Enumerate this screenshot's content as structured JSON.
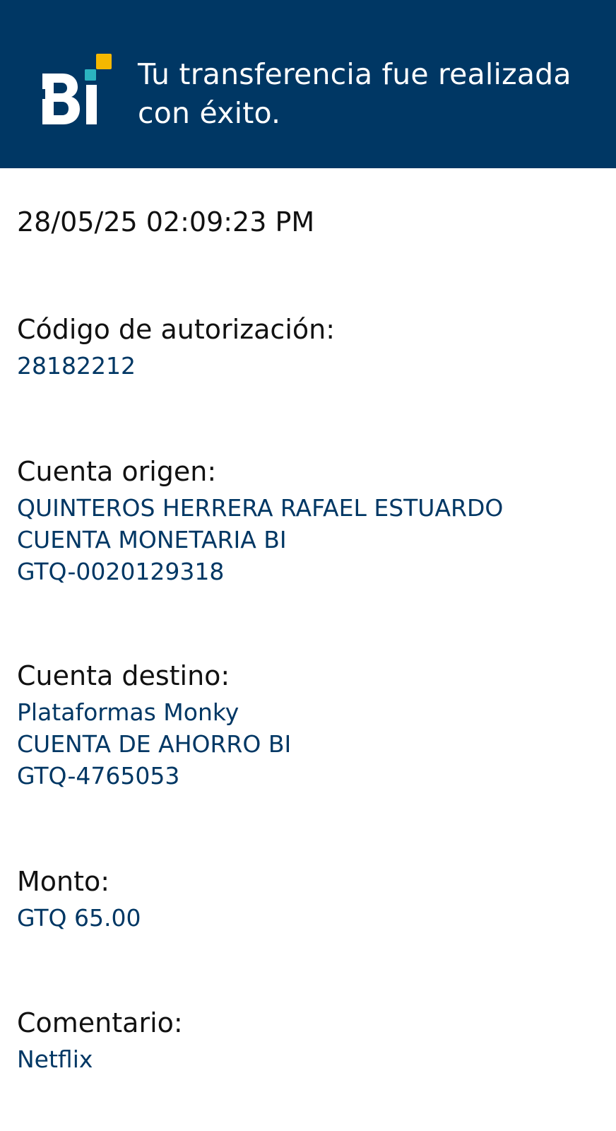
{
  "header": {
    "title": "Tu transferencia fue realizada con éxito.",
    "logo_text": "Bi",
    "colors": {
      "background": "#003764",
      "accent_yellow": "#F5B800",
      "accent_teal": "#2BB3C0"
    }
  },
  "receipt": {
    "datetime": "28/05/25 02:09:23 PM",
    "authorization": {
      "label": "Código de autorización:",
      "value": "28182212"
    },
    "origin": {
      "label": "Cuenta origen:",
      "name": "QUINTEROS HERRERA RAFAEL ESTUARDO",
      "type": "CUENTA MONETARIA BI",
      "number": "GTQ-0020129318"
    },
    "destination": {
      "label": "Cuenta destino:",
      "name": "Plataformas Monky",
      "type": "CUENTA DE AHORRO BI",
      "number": "GTQ-4765053"
    },
    "amount": {
      "label": "Monto:",
      "value": "GTQ 65.00"
    },
    "comment": {
      "label": "Comentario:",
      "value": "Netflix"
    }
  }
}
